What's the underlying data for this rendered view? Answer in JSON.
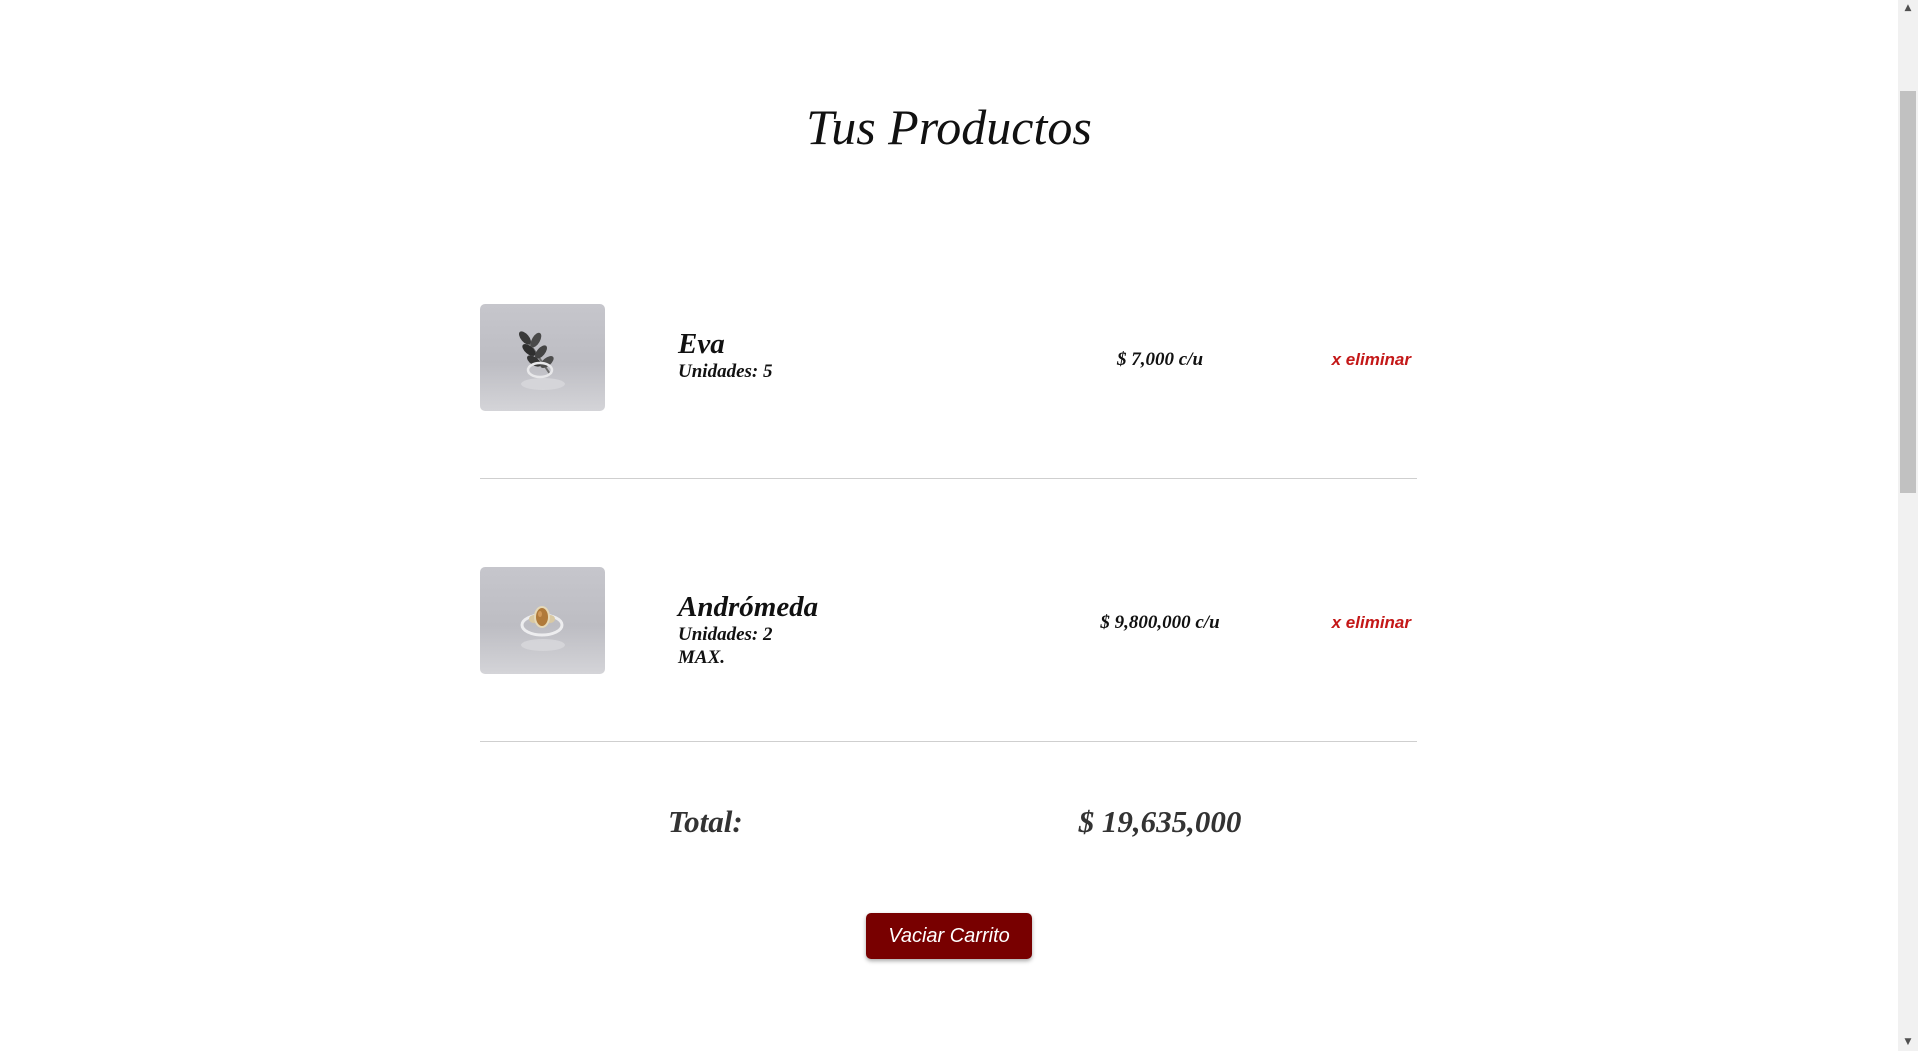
{
  "page": {
    "title": "Tus Productos"
  },
  "cart": {
    "items": [
      {
        "image_icon": "leaf-ring-product-image",
        "name": "Eva",
        "units": "Unidades: 5",
        "max_note": "",
        "price": "$ 7,000 c/u",
        "remove_label": "x eliminar"
      },
      {
        "image_icon": "stone-ring-product-image",
        "name": "Andrómeda",
        "units": "Unidades: 2",
        "max_note": "MAX.",
        "price": "$ 9,800,000 c/u",
        "remove_label": "x eliminar"
      }
    ],
    "total_label": "Total:",
    "total_value": "$ 19,635,000",
    "empty_button_label": "Vaciar Carrito"
  },
  "colors": {
    "accent_button": "#780000",
    "remove_link": "#c41818",
    "divider": "#cfcfcf"
  },
  "scrollbar": {
    "up_icon": "scroll-up-arrow-icon",
    "down_icon": "scroll-down-arrow-icon"
  }
}
